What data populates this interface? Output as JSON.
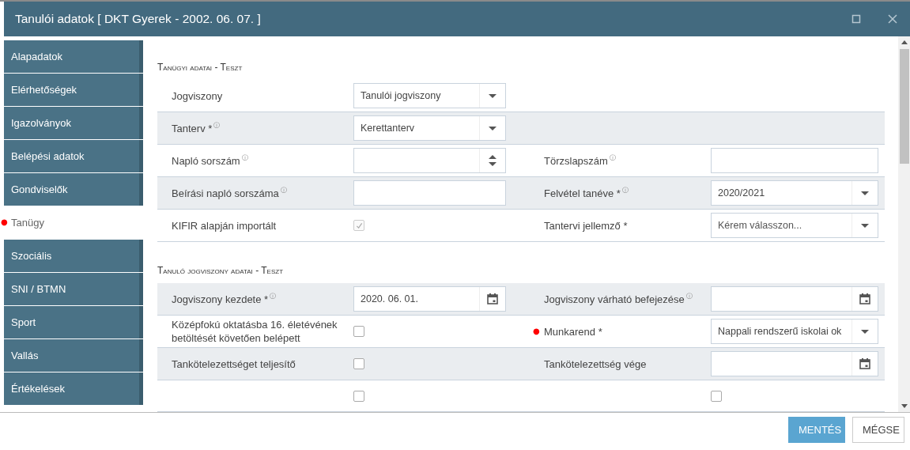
{
  "window": {
    "title": "Tanulói adatok [ DKT Gyerek - 2002. 06. 07. ]"
  },
  "sidebar": {
    "items": [
      {
        "label": "Alapadatok",
        "selected": false
      },
      {
        "label": "Elérhetőségek",
        "selected": false
      },
      {
        "label": "Igazolványok",
        "selected": false
      },
      {
        "label": "Belépési adatok",
        "selected": false
      },
      {
        "label": "Gondviselők",
        "selected": false
      },
      {
        "label": "Tanügy",
        "selected": true,
        "flag": "●"
      },
      {
        "label": "Szociális",
        "selected": false
      },
      {
        "label": "SNI / BTMN",
        "selected": false
      },
      {
        "label": "Sport",
        "selected": false
      },
      {
        "label": "Vallás",
        "selected": false
      },
      {
        "label": "Értékelések",
        "selected": false
      }
    ]
  },
  "sections": [
    {
      "title": "Tanügyi adatai - Teszt",
      "rows": [
        {
          "shaded": false,
          "cells": [
            {
              "label": "Jogviszony",
              "field": {
                "kind": "select",
                "value": "Tanulói jogviszony"
              }
            }
          ]
        },
        {
          "shaded": true,
          "cells": [
            {
              "label": "Tanterv *",
              "info": "ⓘ",
              "field": {
                "kind": "select",
                "value": "Kerettanterv"
              }
            }
          ]
        },
        {
          "shaded": false,
          "cells": [
            {
              "label": "Napló sorszám",
              "info": "ⓘ",
              "field": {
                "kind": "spinner"
              }
            },
            {
              "label": "Törzslapszám",
              "info": "ⓘ",
              "field": {
                "kind": "text"
              }
            }
          ]
        },
        {
          "shaded": true,
          "cells": [
            {
              "label": "Beírási napló sorszáma",
              "info": "ⓘ",
              "field": {
                "kind": "text"
              }
            },
            {
              "label": "Felvétel tanéve *",
              "info": "ⓘ",
              "field": {
                "kind": "select",
                "value": "2020/2021"
              }
            }
          ]
        },
        {
          "shaded": false,
          "cells": [
            {
              "label": "KIFIR alapján importált",
              "field": {
                "kind": "checkbox",
                "checked": true,
                "disabled": true
              }
            },
            {
              "label": "Tantervi jellemző *",
              "field": {
                "kind": "select",
                "placeholder": "Kérem válasszon..."
              }
            }
          ]
        }
      ]
    },
    {
      "title": "Tanuló jogviszony adatai - Teszt",
      "rows": [
        {
          "shaded": true,
          "cells": [
            {
              "label": "Jogviszony kezdete *",
              "info": "ⓘ",
              "field": {
                "kind": "date",
                "value": "2020. 06. 01."
              }
            },
            {
              "label": "Jogviszony várható befejezése",
              "info": "ⓘ",
              "field": {
                "kind": "date"
              }
            }
          ]
        },
        {
          "shaded": false,
          "cells": [
            {
              "label": "Középfokú oktatásba 16. életévének betöltését követően belépett",
              "field": {
                "kind": "checkbox",
                "checked": false,
                "disabled": false
              }
            },
            {
              "flag": "●",
              "label": "Munkarend *",
              "field": {
                "kind": "select",
                "value": "Nappali rendszerű iskolai ok"
              }
            }
          ]
        },
        {
          "shaded": true,
          "cells": [
            {
              "label": "Tankötelezettséget teljesítő",
              "field": {
                "kind": "checkbox",
                "checked": false,
                "disabled": false
              }
            },
            {
              "label": "Tankötelezettség vége",
              "field": {
                "kind": "date"
              }
            }
          ]
        },
        {
          "shaded": false,
          "cells": [
            {
              "field": {
                "kind": "checkbox",
                "checked": false,
                "disabled": false
              }
            },
            {
              "field": {
                "kind": "checkbox",
                "checked": false,
                "disabled": false
              }
            }
          ]
        }
      ]
    }
  ],
  "buttons": [
    {
      "label": "MENTÉS",
      "kind": "primary"
    },
    {
      "label": "MÉGSE",
      "kind": "secondary"
    }
  ]
}
